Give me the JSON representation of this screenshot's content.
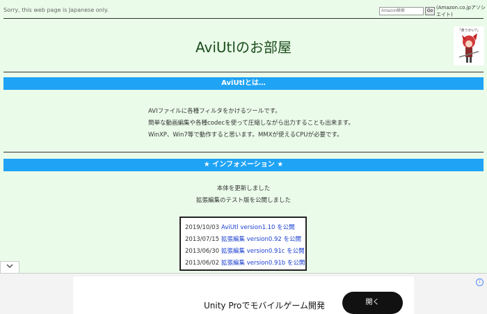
{
  "header": {
    "note": "Sorry, this web page is Japanese only.",
    "search_placeholder": "Amazon検索",
    "go_label": "Go",
    "amazon_link": "(Amazon.co.jpアソシエイト)"
  },
  "site": {
    "title": "AviUtlのお部屋",
    "mascot_caption": "「食うかい?」"
  },
  "about": {
    "heading": "AviUtlとは…",
    "lines": [
      "AVIファイルに各種フィルタをかけるツールです。",
      "簡単な動画編集や各種codecを使って圧縮しながら出力することも出来ます。",
      "WinXP、Win7等で動作すると思います。MMXが使えるCPUが必要です。"
    ]
  },
  "info": {
    "heading": "★ インフォメーション ★",
    "lines": [
      "本体を更新しました",
      "拡張編集のテスト版を公開しました"
    ]
  },
  "news": [
    {
      "date": "2019/10/03",
      "link": "AviUtl version1.10 を公開"
    },
    {
      "date": "2013/07/15",
      "link": "拡張編集 version0.92 を公開"
    },
    {
      "date": "2013/06/30",
      "link": "拡張編集 version0.91c を公開"
    },
    {
      "date": "2013/06/02",
      "link": "拡張編集 version0.91b を公開"
    }
  ],
  "ad": {
    "text": "Unity Proでモバイルゲーム開発",
    "button": "開く",
    "info_glyph": "i"
  },
  "icons": {
    "collapse": "chevron-down-icon"
  }
}
